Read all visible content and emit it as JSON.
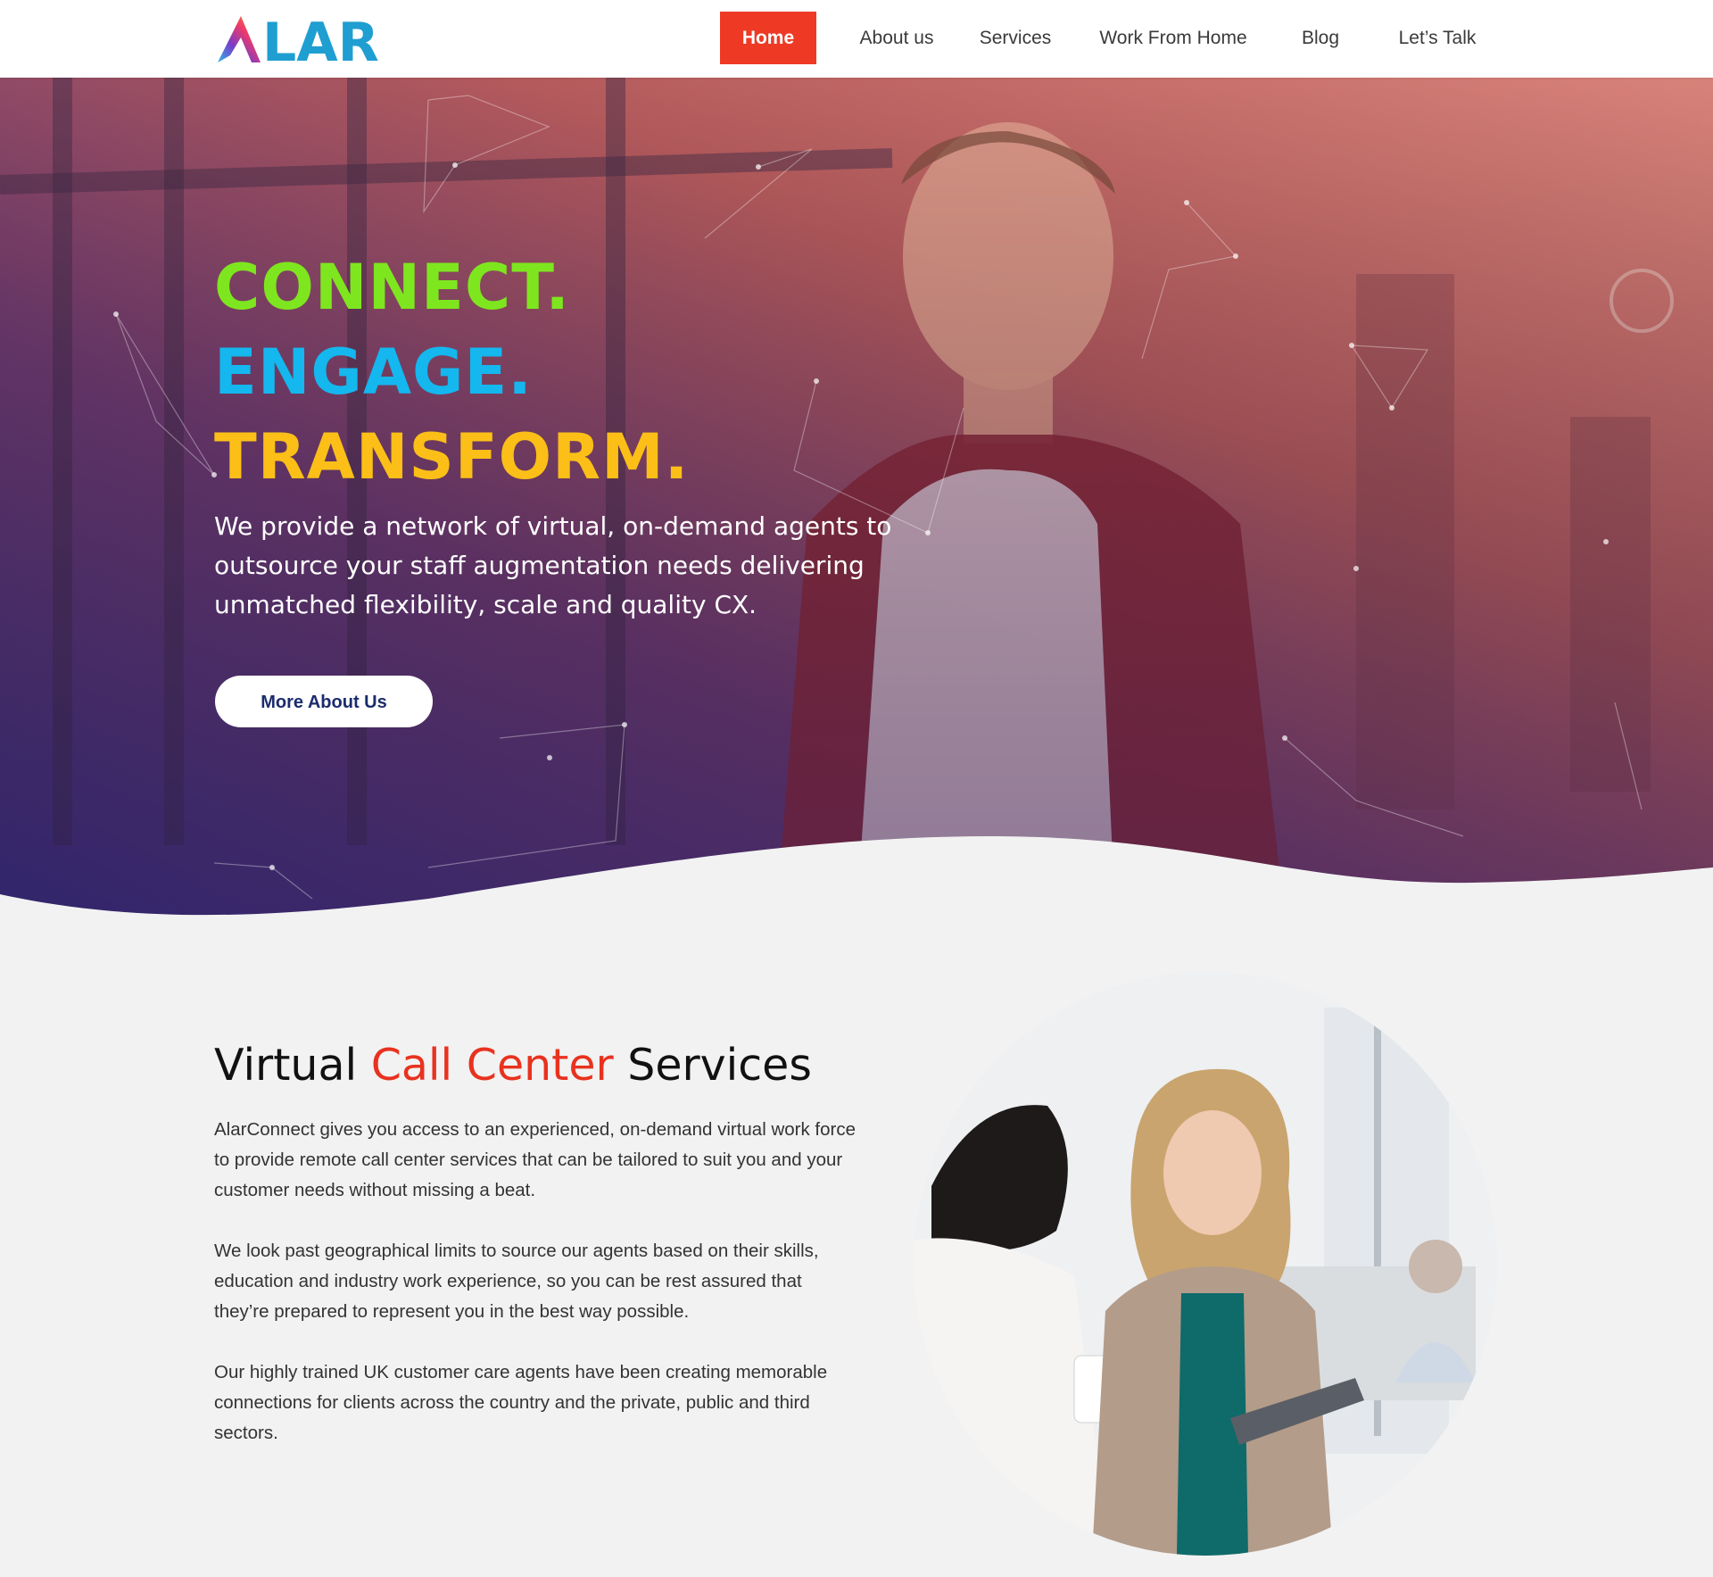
{
  "header": {
    "logo_text": "ALAR",
    "nav": [
      {
        "label": "Home",
        "active": true
      },
      {
        "label": "About us",
        "active": false
      },
      {
        "label": "Services",
        "active": false
      },
      {
        "label": "Work From Home",
        "active": false
      },
      {
        "label": "Blog",
        "active": false
      },
      {
        "label": "Let’s Talk",
        "active": false
      }
    ]
  },
  "hero": {
    "lines": [
      "CONNECT.",
      "ENGAGE.",
      "TRANSFORM."
    ],
    "subtitle": "We provide a network of virtual, on-demand agents to outsource your staff augmentation needs delivering unmatched flexibility, scale and quality CX.",
    "button_label": "More About Us"
  },
  "services": {
    "heading_part1": "Virtual ",
    "heading_accent": "Call Center",
    "heading_part2": " Services",
    "paragraphs": [
      "AlarConnect gives you access to an experienced, on-demand virtual work force to provide remote call center services that can be tailored to suit you and your customer needs without missing a beat.",
      "We look past geographical limits to source our agents based on their skills, education and industry work experience, so you can be rest assured that they’re prepared to represent you in the best way possible.",
      "Our highly trained UK customer care agents have been creating memorable connections for clients across the country and the private, public and third sectors."
    ]
  },
  "colors": {
    "accent_red": "#ee3a25",
    "hero_green": "#7ee61e",
    "hero_blue": "#14b7ee",
    "hero_yellow": "#fbbf18",
    "button_text": "#1a2c6d"
  },
  "icons": [
    "alar-logo-icon"
  ]
}
